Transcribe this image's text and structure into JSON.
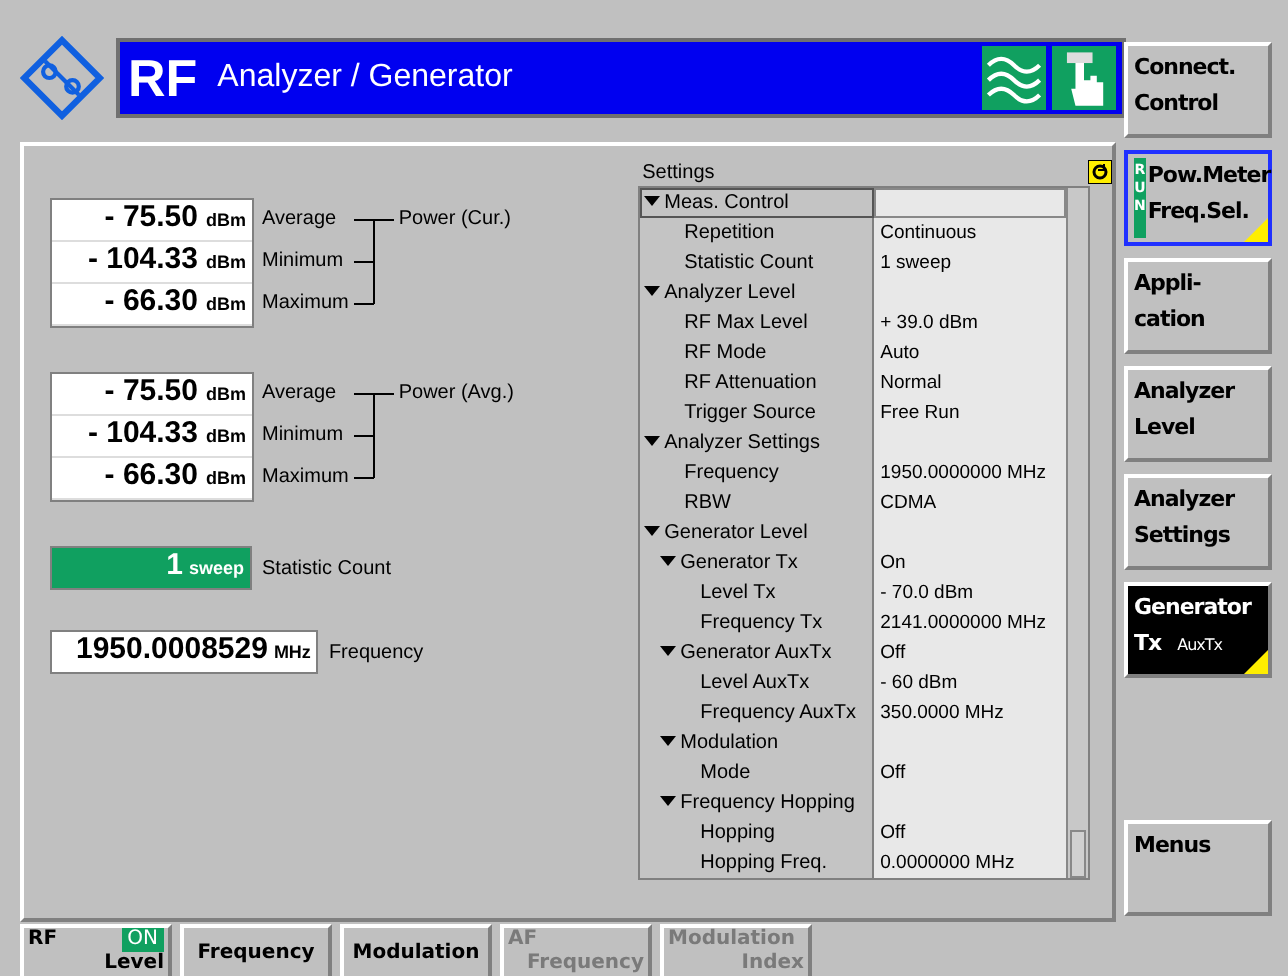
{
  "header": {
    "title_main": "RF",
    "title_sub": "Analyzer / Generator"
  },
  "readings": [
    {
      "group_label": "Power (Cur.)",
      "rows": [
        {
          "value": "- 75.50",
          "unit": "dBm",
          "label": "Average"
        },
        {
          "value": "- 104.33",
          "unit": "dBm",
          "label": "Minimum"
        },
        {
          "value": "- 66.30",
          "unit": "dBm",
          "label": "Maximum"
        }
      ]
    },
    {
      "group_label": "Power (Avg.)",
      "rows": [
        {
          "value": "- 75.50",
          "unit": "dBm",
          "label": "Average"
        },
        {
          "value": "- 104.33",
          "unit": "dBm",
          "label": "Minimum"
        },
        {
          "value": "- 66.30",
          "unit": "dBm",
          "label": "Maximum"
        }
      ]
    }
  ],
  "statistic_count": {
    "value": "1",
    "unit": "sweep",
    "label": "Statistic Count"
  },
  "frequency": {
    "value": "1950.0008529",
    "unit": "MHz",
    "label": "Frequency"
  },
  "settings": {
    "title": "Settings",
    "items": [
      {
        "label": "Meas. Control",
        "selected": true,
        "expanded": true,
        "children": [
          {
            "label": "Repetition",
            "value": "Continuous",
            "selected": false
          },
          {
            "label": "Statistic Count",
            "value": "1  sweep",
            "selected": false
          }
        ]
      },
      {
        "label": "Analyzer Level",
        "selected": false,
        "expanded": true,
        "children": [
          {
            "label": "RF Max Level",
            "value": "+ 39.0  dBm",
            "selected": false
          },
          {
            "label": "RF Mode",
            "value": "Auto",
            "selected": false
          },
          {
            "label": "RF Attenuation",
            "value": "Normal",
            "selected": false
          },
          {
            "label": "Trigger Source",
            "value": "Free Run",
            "selected": false
          }
        ]
      },
      {
        "label": "Analyzer Settings",
        "selected": false,
        "expanded": true,
        "children": [
          {
            "label": "Frequency",
            "value": "1950.0000000 MHz",
            "selected": false
          },
          {
            "label": "RBW",
            "value": "CDMA",
            "selected": false
          }
        ]
      },
      {
        "label": "Generator Level",
        "selected": false,
        "expanded": true,
        "children": [
          {
            "label": "Generator Tx",
            "value": "On",
            "selected": false,
            "expanded": true,
            "children": [
              {
                "label": "Level Tx",
                "value": "- 70.0  dBm",
                "selected": false
              },
              {
                "label": "Frequency Tx",
                "value": "2141.0000000 MHz",
                "selected": false
              }
            ]
          },
          {
            "label": "Generator AuxTx",
            "value": "Off",
            "selected": false,
            "expanded": true,
            "children": [
              {
                "label": "Level AuxTx",
                "value": "- 60  dBm",
                "selected": false
              },
              {
                "label": "Frequency AuxTx",
                "value": "350.0000  MHz",
                "selected": false
              }
            ]
          },
          {
            "label": "Modulation",
            "selected": false,
            "expanded": true,
            "children": [
              {
                "label": "Mode",
                "value": "Off",
                "selected": false
              }
            ]
          },
          {
            "label": "Frequency Hopping",
            "selected": false,
            "expanded": true,
            "children": [
              {
                "label": "Hopping",
                "value": "Off",
                "selected": false
              },
              {
                "label": "Hopping Freq.",
                "value": "0.0000000 MHz",
                "selected": false
              }
            ]
          }
        ]
      }
    ]
  },
  "softkeys": [
    {
      "lines": [
        "Connect.",
        "Control"
      ],
      "selected": false,
      "highlighted": false,
      "has_submenu": false
    },
    {
      "lines": [
        "Pow.Meter",
        "Freq.Sel."
      ],
      "badge": "RUN",
      "selected": true,
      "highlighted": false,
      "has_submenu": true
    },
    {
      "lines": [
        "Appli-",
        "cation"
      ],
      "selected": false,
      "highlighted": false,
      "has_submenu": false
    },
    {
      "lines": [
        "Analyzer",
        "Level"
      ],
      "selected": false,
      "highlighted": false,
      "has_submenu": false
    },
    {
      "lines": [
        "Analyzer",
        "Settings"
      ],
      "selected": false,
      "highlighted": false,
      "has_submenu": false
    },
    {
      "lines": [
        "Generator",
        "Tx"
      ],
      "sub": "AuxTx",
      "selected": false,
      "highlighted": true,
      "has_submenu": true
    },
    {
      "lines": [
        "Menus"
      ],
      "selected": false,
      "highlighted": false,
      "has_submenu": false,
      "kind": "bottom"
    }
  ],
  "hotkeys": [
    {
      "top": "RF",
      "bottom": "Level",
      "badge": "ON",
      "disabled": false
    },
    {
      "top": "Frequency",
      "disabled": false
    },
    {
      "top": "Modulation",
      "disabled": false
    },
    {
      "top": "AF",
      "bottom": "Frequency",
      "disabled": true
    },
    {
      "top": "Modulation",
      "bottom": "Index",
      "disabled": true
    }
  ]
}
